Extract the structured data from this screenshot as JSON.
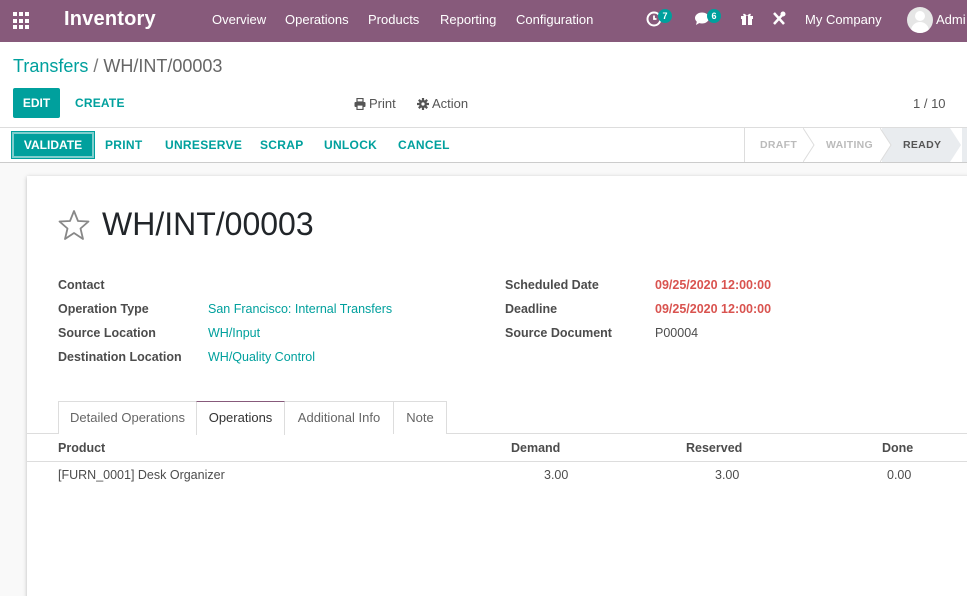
{
  "navbar": {
    "app_name": "Inventory",
    "menu": [
      "Overview",
      "Operations",
      "Products",
      "Reporting",
      "Configuration"
    ],
    "activity_count": "7",
    "message_count": "6",
    "company": "My Company",
    "user": "Admi"
  },
  "control_panel": {
    "breadcrumb_parent": "Transfers",
    "breadcrumb_separator": "/",
    "breadcrumb_current": "WH/INT/00003",
    "edit_label": "EDIT",
    "create_label": "CREATE",
    "print_label": "Print",
    "action_label": "Action",
    "pager": "1 / 10"
  },
  "statusbar": {
    "validate_label": "VALIDATE",
    "actions": [
      "PRINT",
      "UNRESERVE",
      "SCRAP",
      "UNLOCK",
      "CANCEL"
    ],
    "stages": [
      "DRAFT",
      "WAITING",
      "READY"
    ],
    "current_stage": "READY"
  },
  "form": {
    "title": "WH/INT/00003",
    "left_fields": [
      {
        "label": "Contact",
        "value": ""
      },
      {
        "label": "Operation Type",
        "value": "San Francisco: Internal Transfers"
      },
      {
        "label": "Source Location",
        "value": "WH/Input"
      },
      {
        "label": "Destination Location",
        "value": "WH/Quality Control"
      }
    ],
    "right_fields": [
      {
        "label": "Scheduled Date",
        "value": "09/25/2020 12:00:00"
      },
      {
        "label": "Deadline",
        "value": "09/25/2020 12:00:00"
      },
      {
        "label": "Source Document",
        "value": "P00004"
      }
    ],
    "tabs": [
      "Detailed Operations",
      "Operations",
      "Additional Info",
      "Note"
    ],
    "active_tab": "Operations"
  },
  "table": {
    "columns": [
      "Product",
      "Demand",
      "Reserved",
      "Done"
    ],
    "rows": [
      {
        "product": "[FURN_0001] Desk Organizer",
        "demand": "3.00",
        "reserved": "3.00",
        "done": "0.00"
      }
    ]
  },
  "colors": {
    "navbar": "#875a7b",
    "accent": "#00a09d",
    "date_warning": "#d9534f"
  }
}
